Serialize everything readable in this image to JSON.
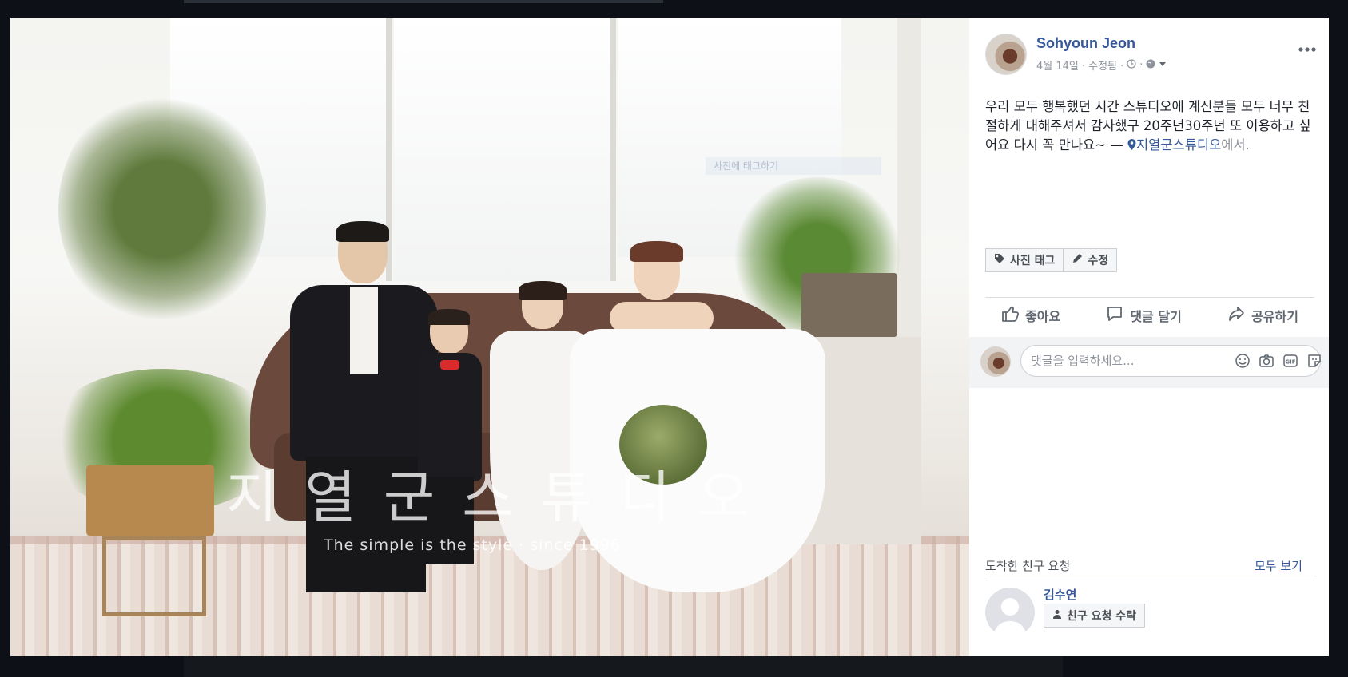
{
  "post": {
    "author_name": "Sohyoun Jeon",
    "date": "4월 14일",
    "edited_label": "· 수정됨 ·",
    "caption_text": "우리 모두 행복했던 시간 스튜디오에 계신분들 모두 너무 친절하게 대해주셔서 감사했구 20주년30주년 또 이용하고 싶어요 다시 꼭 만나요~ — ",
    "location_name": "지열군스튜디오",
    "location_suffix": "에서."
  },
  "photo": {
    "watermark_title": "지열군스튜디오",
    "watermark_tagline": "The simple is the style  ·  since 1996",
    "tag_hint": "사진에 태그하기"
  },
  "tag_buttons": {
    "tag_photo": "사진 태그",
    "edit": "수정"
  },
  "actions": {
    "like": "좋아요",
    "comment": "댓글 달기",
    "share": "공유하기"
  },
  "comment_box": {
    "placeholder": "댓글을 입력하세요..."
  },
  "friend_requests": {
    "title": "도착한 친구 요청",
    "see_all": "모두 보기",
    "requester_name": "김수연",
    "accept_label": "친구 요청 수락"
  },
  "colors": {
    "link": "#365899",
    "muted": "#90949c",
    "text": "#1d2129"
  }
}
